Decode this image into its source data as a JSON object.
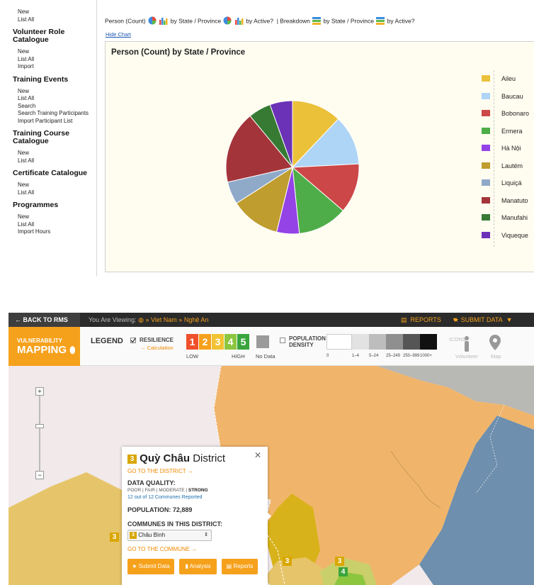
{
  "sidebar": {
    "sections": [
      {
        "title": "",
        "links": [
          "New",
          "List All"
        ]
      },
      {
        "title": "Volunteer Role Catalogue",
        "links": [
          "New",
          "List All",
          "Import"
        ]
      },
      {
        "title": "Training Events",
        "links": [
          "New",
          "List All",
          "Search",
          "Search Training Participants",
          "Import Participant List"
        ]
      },
      {
        "title": "Training Course Catalogue",
        "links": [
          "New",
          "List All"
        ]
      },
      {
        "title": "Certificate Catalogue",
        "links": [
          "New",
          "List All"
        ]
      },
      {
        "title": "Programmes",
        "links": [
          "New",
          "List All",
          "Import Hours"
        ]
      }
    ]
  },
  "report": {
    "crumb_a": "Person (Count)",
    "crumb_b": "by State / Province",
    "crumb_c": "by Active?",
    "crumb_d": "| Breakdown",
    "crumb_e": "by State / Province",
    "crumb_f": "by Active?",
    "hide_chart": "Hide Chart"
  },
  "chart_data": {
    "type": "pie",
    "title": "Person (Count) by State / Province",
    "legend_position": "right",
    "categories": [
      "Aileu",
      "Baucau",
      "Bobonaro",
      "Ermera",
      "Hà Nội",
      "Lautém",
      "Liquiçá",
      "Manatuto",
      "Manufahi",
      "Viqueque"
    ],
    "values": [
      11,
      11,
      11,
      11,
      5,
      11,
      5,
      16,
      5,
      5
    ],
    "colors": [
      "#ecc13a",
      "#aed4f6",
      "#cc4747",
      "#4ead48",
      "#9443e6",
      "#bf9d2e",
      "#8fa9c9",
      "#a3353a",
      "#367a33",
      "#6b32b8"
    ]
  },
  "rms": {
    "back": "← BACK TO RMS",
    "viewing_prefix": "You Are Viewing:",
    "viewing_path": "» Viet Nam » Nghệ An",
    "reports": "REPORTS",
    "submit": "SUBMIT DATA",
    "logo_small": "VULNERABILITY",
    "logo_big": "MAPPING",
    "legend": "LEGEND",
    "resilience": "RESILIENCE",
    "calculation": "→ Calculation",
    "scale": [
      "1",
      "2",
      "3",
      "4",
      "5"
    ],
    "scale_colors": [
      "#f0502c",
      "#f6a11c",
      "#f1c232",
      "#8cc63f",
      "#3aa53c"
    ],
    "low": "LOW",
    "high": "HIGH",
    "nodata": "No Data",
    "population_density": "POPULATION DENSITY",
    "density_labels": [
      "0",
      "1–4",
      "5–24",
      "25–249",
      "250–999",
      "1000+"
    ],
    "icons": "ICONS",
    "volunteer": "Volunteer",
    "map": "Map"
  },
  "popup": {
    "badge": "3",
    "district": "Quỳ Châu",
    "district_suffix": "District",
    "goto_district": "GO TO THE DISTRICT →",
    "dq_label": "DATA QUALITY:",
    "dq_scale": "POOR | FAIR | MODERATE |",
    "dq_strong": "STRONG",
    "communes_reported": "12 out of 12 Communes Reported",
    "population": "POPULATION: 72,889",
    "communes_label": "COMMUNES IN THIS DISTRICT:",
    "commune_badge": "3",
    "commune_selected": "Châu Bình",
    "goto_commune": "GO TO THE COMMUNE →",
    "btn_submit": "Submit Data",
    "btn_analysis": "Analysis",
    "btn_reports": "Reports",
    "close": "✕"
  },
  "map_badges": [
    "3",
    "3",
    "3",
    "4"
  ]
}
